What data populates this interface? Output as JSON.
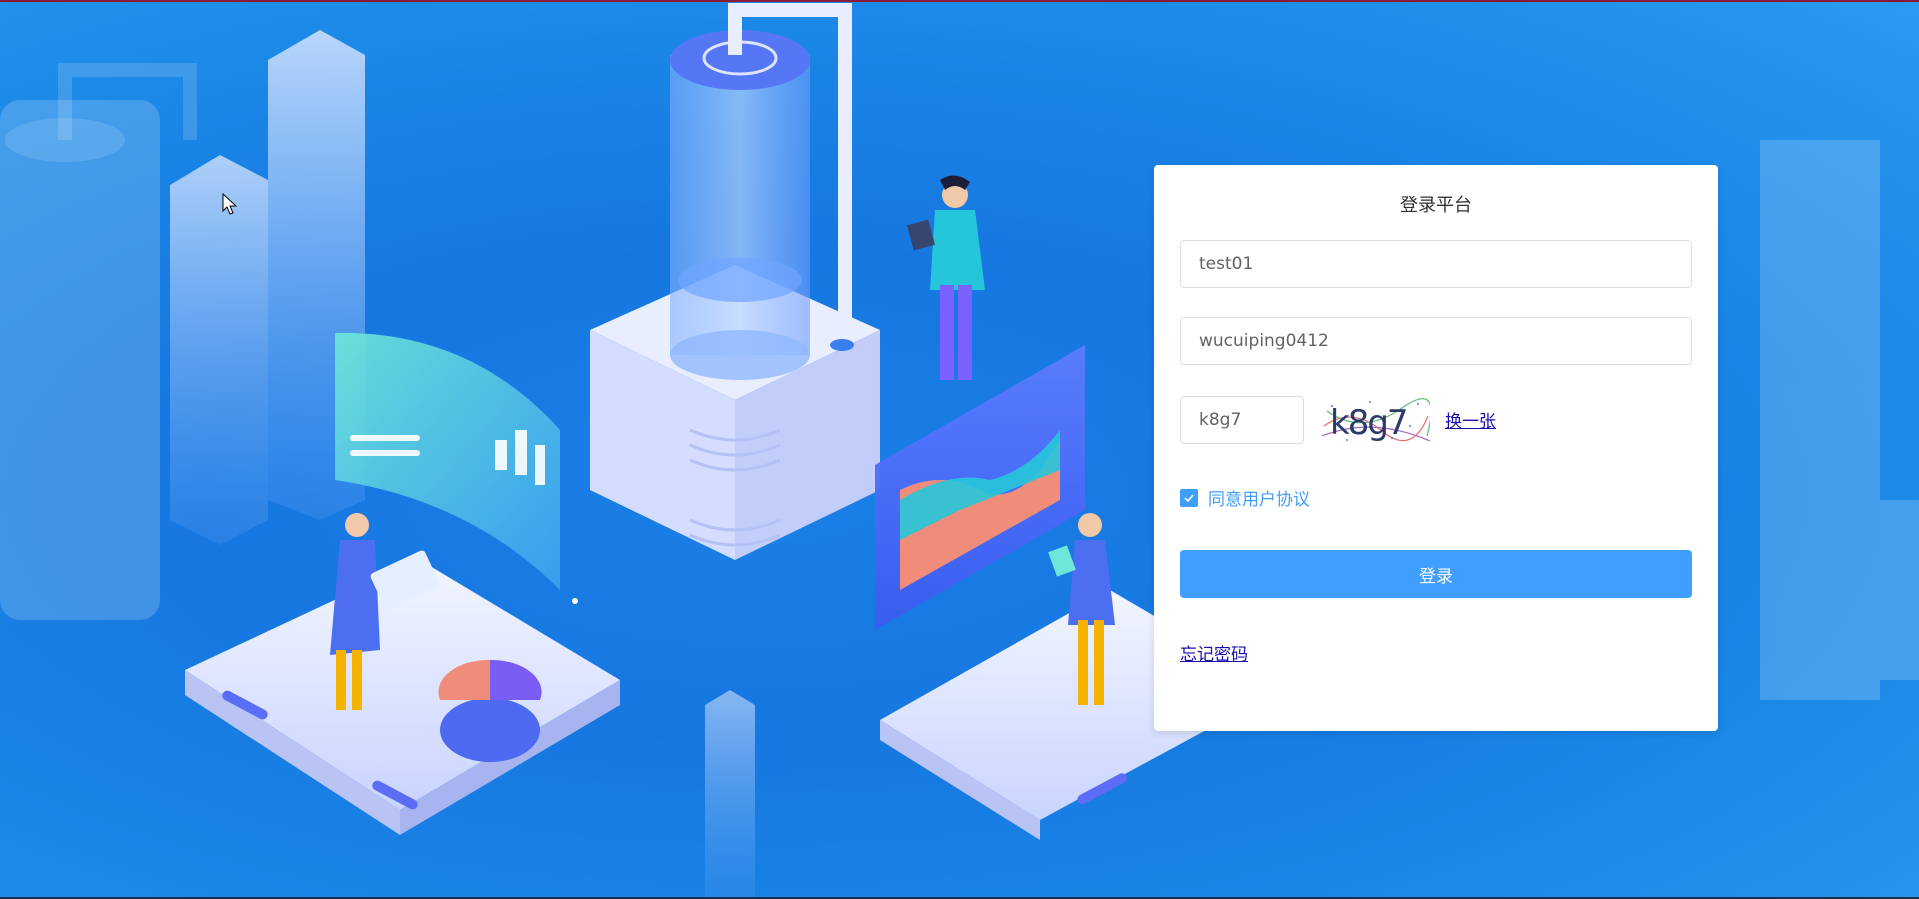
{
  "login": {
    "title": "登录平台",
    "username_value": "test01",
    "password_value": "wucuiping0412",
    "captcha_value": "k8g7",
    "captcha_image_text": "k8g7",
    "captcha_refresh_label": "换一张",
    "agree_label": "同意用户协议",
    "agree_checked": true,
    "submit_label": "登录",
    "forgot_label": "忘记密码"
  },
  "colors": {
    "primary": "#409eff",
    "background": "#1e88e5",
    "link": "#1a0dab",
    "card": "#ffffff"
  }
}
